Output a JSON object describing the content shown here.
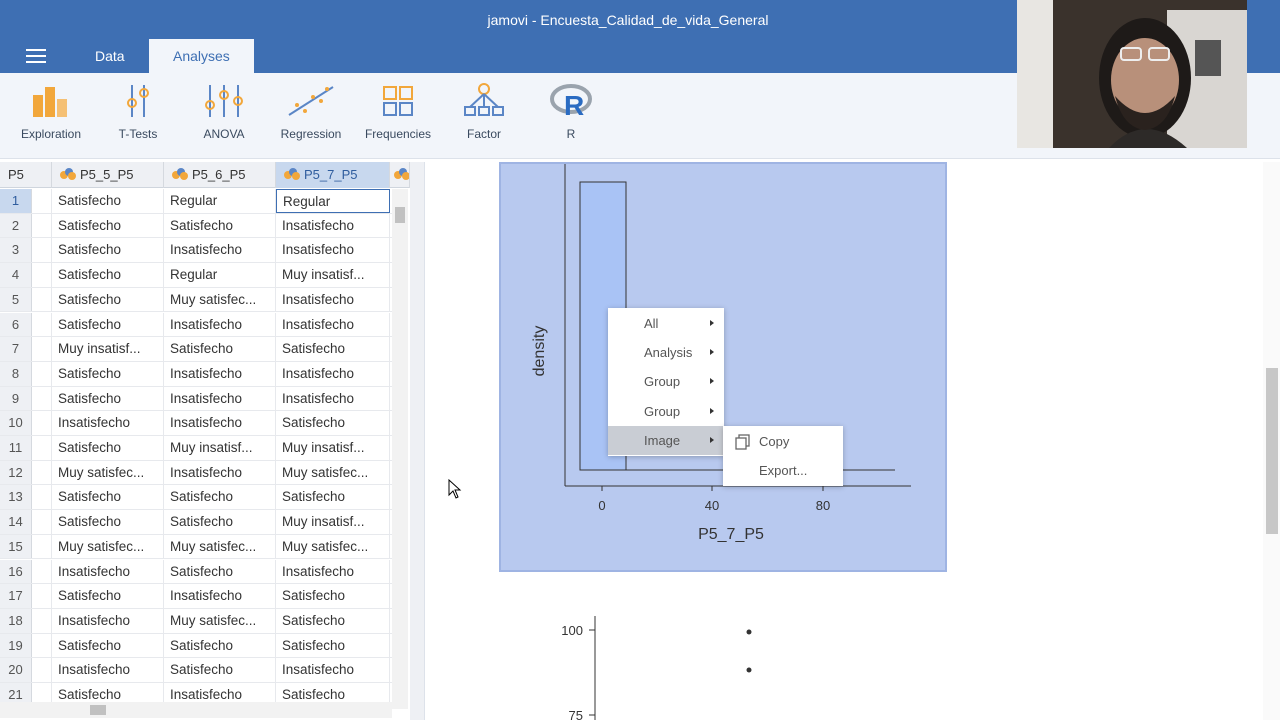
{
  "window": {
    "title": "jamovi - Encuesta_Calidad_de_vida_General"
  },
  "tabs": [
    {
      "label": "Data"
    },
    {
      "label": "Analyses"
    }
  ],
  "ribbon": [
    {
      "label": "Exploration",
      "icon": "exploration-icon"
    },
    {
      "label": "T-Tests",
      "icon": "t-tests-icon"
    },
    {
      "label": "ANOVA",
      "icon": "anova-icon"
    },
    {
      "label": "Regression",
      "icon": "regression-icon"
    },
    {
      "label": "Frequencies",
      "icon": "frequencies-icon"
    },
    {
      "label": "Factor",
      "icon": "factor-icon"
    },
    {
      "label": "R",
      "icon": "r-icon"
    }
  ],
  "sheet": {
    "partial_col": "P5",
    "columns": [
      "P5_5_P5",
      "P5_6_P5",
      "P5_7_P5"
    ],
    "selected_column": "P5_7_P5",
    "rows": [
      {
        "n": "1",
        "c": [
          "Satisfecho",
          "Regular",
          "Regular"
        ]
      },
      {
        "n": "2",
        "c": [
          "Satisfecho",
          "Satisfecho",
          "Insatisfecho"
        ]
      },
      {
        "n": "3",
        "c": [
          "Satisfecho",
          "Insatisfecho",
          "Insatisfecho"
        ]
      },
      {
        "n": "4",
        "c": [
          "Satisfecho",
          "Regular",
          "Muy insatisf..."
        ]
      },
      {
        "n": "5",
        "c": [
          "Satisfecho",
          "Muy satisfec...",
          "Insatisfecho"
        ]
      },
      {
        "n": "6",
        "c": [
          "Satisfecho",
          "Insatisfecho",
          "Insatisfecho"
        ]
      },
      {
        "n": "7",
        "c": [
          "Muy insatisf...",
          "Satisfecho",
          "Satisfecho"
        ]
      },
      {
        "n": "8",
        "c": [
          "Satisfecho",
          "Insatisfecho",
          "Insatisfecho"
        ]
      },
      {
        "n": "9",
        "c": [
          "Satisfecho",
          "Insatisfecho",
          "Insatisfecho"
        ]
      },
      {
        "n": "10",
        "c": [
          "Insatisfecho",
          "Insatisfecho",
          "Satisfecho"
        ]
      },
      {
        "n": "11",
        "c": [
          "Satisfecho",
          "Muy insatisf...",
          "Muy insatisf..."
        ]
      },
      {
        "n": "12",
        "c": [
          "Muy satisfec...",
          "Insatisfecho",
          "Muy satisfec..."
        ]
      },
      {
        "n": "13",
        "c": [
          "Satisfecho",
          "Satisfecho",
          "Satisfecho"
        ]
      },
      {
        "n": "14",
        "c": [
          "Satisfecho",
          "Satisfecho",
          "Muy insatisf..."
        ]
      },
      {
        "n": "15",
        "c": [
          "Muy satisfec...",
          "Muy satisfec...",
          "Muy satisfec..."
        ]
      },
      {
        "n": "16",
        "c": [
          "Insatisfecho",
          "Satisfecho",
          "Insatisfecho"
        ]
      },
      {
        "n": "17",
        "c": [
          "Satisfecho",
          "Insatisfecho",
          "Satisfecho"
        ]
      },
      {
        "n": "18",
        "c": [
          "Insatisfecho",
          "Muy satisfec...",
          "Satisfecho"
        ]
      },
      {
        "n": "19",
        "c": [
          "Satisfecho",
          "Satisfecho",
          "Satisfecho"
        ]
      },
      {
        "n": "20",
        "c": [
          "Insatisfecho",
          "Satisfecho",
          "Insatisfecho"
        ]
      },
      {
        "n": "21",
        "c": [
          "Satisfecho",
          "Insatisfecho",
          "Satisfecho"
        ]
      }
    ]
  },
  "plot1": {
    "ylabel": "density",
    "xlabel": "P5_7_P5",
    "xticks": [
      "0",
      "40",
      "80"
    ]
  },
  "plot2": {
    "yticks": [
      "100",
      "75"
    ]
  },
  "context_menu": {
    "items": [
      {
        "label": "All"
      },
      {
        "label": "Analysis"
      },
      {
        "label": "Group"
      },
      {
        "label": "Group"
      },
      {
        "label": "Image"
      }
    ],
    "submenu": [
      {
        "label": "Copy",
        "icon": "copy-icon"
      },
      {
        "label": "Export..."
      }
    ]
  },
  "colors": {
    "brand": "#3e6fb3",
    "plot_bg": "#b8c9ef"
  }
}
